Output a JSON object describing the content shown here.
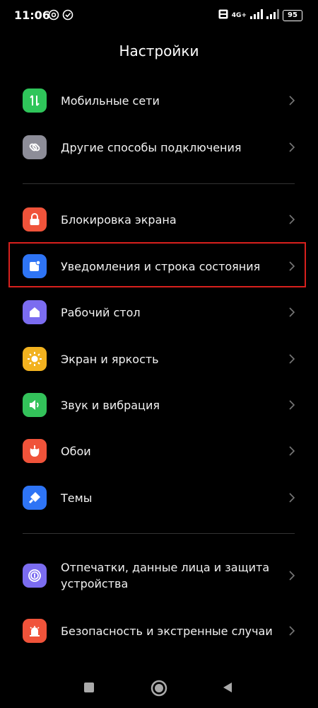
{
  "status_bar": {
    "time": "11:06",
    "network": "4G+",
    "battery": "95"
  },
  "page_title": "Настройки",
  "groups": [
    {
      "items": [
        {
          "label": "Мобильные сети",
          "icon": "mobile-data-icon",
          "color": "#2fc55a"
        },
        {
          "label": "Другие способы подключения",
          "icon": "link-icon",
          "color": "#8d8d98"
        }
      ]
    },
    {
      "items": [
        {
          "label": "Блокировка экрана",
          "icon": "lock-icon",
          "color": "#f0533a"
        },
        {
          "label": "Уведомления и строка состояния",
          "icon": "notification-icon",
          "color": "#2e74f5",
          "highlighted": true
        },
        {
          "label": "Рабочий стол",
          "icon": "home-icon",
          "color": "#7b6cf0"
        },
        {
          "label": "Экран и яркость",
          "icon": "brightness-icon",
          "color": "#f2b21f"
        },
        {
          "label": "Звук и вибрация",
          "icon": "sound-icon",
          "color": "#33c25a"
        },
        {
          "label": "Обои",
          "icon": "wallpaper-icon",
          "color": "#f0533a"
        },
        {
          "label": "Темы",
          "icon": "themes-icon",
          "color": "#2e74f5"
        }
      ]
    },
    {
      "items": [
        {
          "label": "Отпечатки, данные лица и защита устройства",
          "icon": "fingerprint-icon",
          "color": "#7b6cf0"
        },
        {
          "label": "Безопасность и экстренные случаи",
          "icon": "emergency-icon",
          "color": "#f0533a"
        }
      ]
    }
  ],
  "nav": {
    "recents": "recents-icon",
    "home": "home-button-icon",
    "back": "back-icon"
  }
}
